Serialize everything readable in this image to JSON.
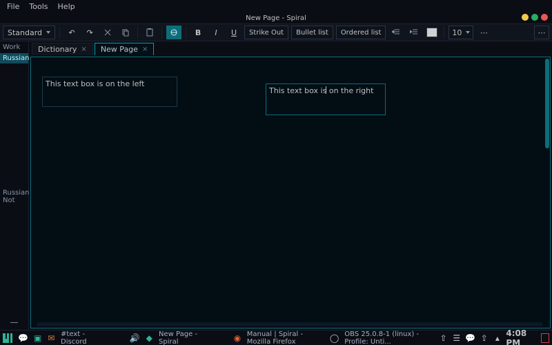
{
  "window": {
    "title": "New Page - Spiral"
  },
  "menubar": [
    "File",
    "Tools",
    "Help"
  ],
  "toolbar": {
    "style": "Standard",
    "strikeout": "Strike Out",
    "bullet": "Bullet list",
    "ordered": "Ordered list",
    "fontsize": "10"
  },
  "sidebar": {
    "heading": "Work",
    "items": [
      "Russian",
      "Russian Not"
    ]
  },
  "tabs": [
    {
      "label": "Dictionary",
      "active": false
    },
    {
      "label": "New Page",
      "active": true
    }
  ],
  "canvas": {
    "textboxes": [
      {
        "text": "This text box is on the left"
      },
      {
        "text": "This text box is on the right"
      }
    ]
  },
  "taskbar": {
    "items": [
      "#text - Discord",
      "New Page - Spiral",
      "Manual | Spiral - Mozilla Firefox",
      "OBS 25.0.8-1 (linux) - Profile: Unti..."
    ],
    "clock": "4:08 PM"
  }
}
